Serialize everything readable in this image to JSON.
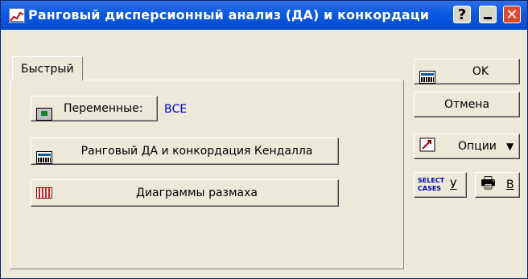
{
  "window": {
    "title": "Ранговый дисперсионный анализ (ДА) и конкордаци",
    "help_label": "?",
    "close_label": "✕"
  },
  "tab": {
    "label": "Быстрый"
  },
  "variables": {
    "label": "Переменные:",
    "value": "ВСЕ"
  },
  "ranking_button": {
    "label": "Ранговый ДА и конкордация Кендалла"
  },
  "boxplot_button": {
    "label": "Диаграммы размаха"
  },
  "side": {
    "ok_label": "OK",
    "cancel_label": "Отмена",
    "options_label": "Опции",
    "options_arrow": "▼",
    "select_cases_label": "SELECT CASES",
    "select_key": "У",
    "print_key": "В"
  },
  "icons": {
    "variables": "screen-icon",
    "ranking": "grid-icon",
    "boxplot": "box-plot-icon",
    "ok": "grid-icon",
    "options": "options-icon",
    "print": "printer-icon"
  }
}
